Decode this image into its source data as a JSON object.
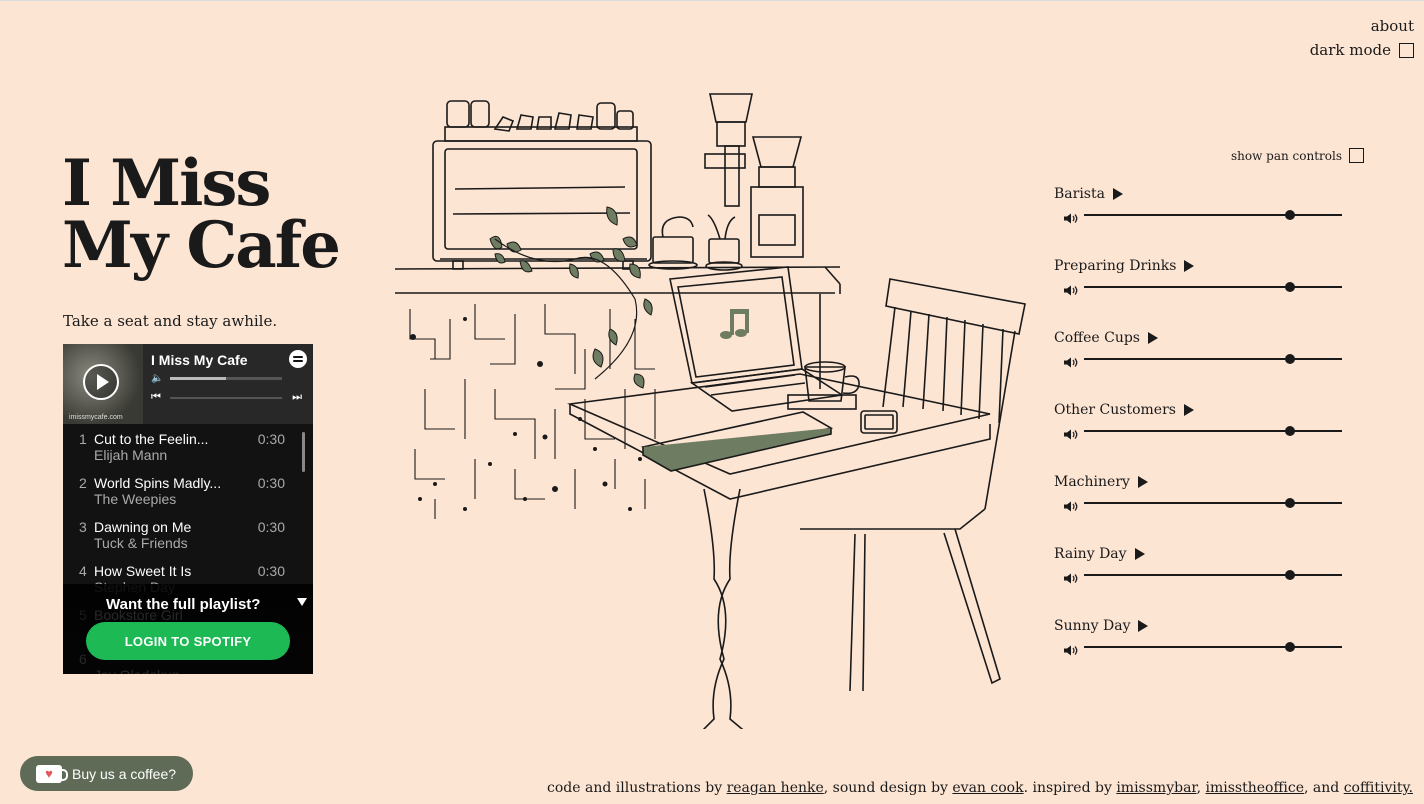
{
  "nav": {
    "about": "about",
    "dark_mode": "dark mode"
  },
  "hero": {
    "title_line1": "I Miss",
    "title_line2": "My Cafe",
    "tagline": "Take a seat and stay awhile."
  },
  "player": {
    "title": "I Miss My Cafe",
    "cover_text": "imissmycafe.com",
    "volume_fraction": 0.5,
    "tracks": [
      {
        "n": "1",
        "title": "Cut to the Feelin...",
        "artist": "Elijah Mann",
        "dur": "0:30"
      },
      {
        "n": "2",
        "title": "World Spins Madly...",
        "artist": "The Weepies",
        "dur": "0:30"
      },
      {
        "n": "3",
        "title": "Dawning on Me",
        "artist": "Tuck & Friends",
        "dur": "0:30"
      },
      {
        "n": "4",
        "title": "How Sweet It Is",
        "artist": "Stephen Day",
        "dur": "0:30"
      },
      {
        "n": "5",
        "title": "Bookstore Girl",
        "artist": "",
        "dur": ""
      },
      {
        "n": "6",
        "title": "",
        "artist": "Jay Oladokun",
        "dur": ""
      }
    ],
    "cta": "Want the full playlist?",
    "login": "LOGIN TO SPOTIFY"
  },
  "controls": {
    "pan_label": "show pan controls",
    "sounds": [
      {
        "name": "Barista",
        "volume": 0.8
      },
      {
        "name": "Preparing Drinks",
        "volume": 0.8
      },
      {
        "name": "Coffee Cups",
        "volume": 0.8
      },
      {
        "name": "Other Customers",
        "volume": 0.8
      },
      {
        "name": "Machinery",
        "volume": 0.8
      },
      {
        "name": "Rainy Day",
        "volume": 0.8
      },
      {
        "name": "Sunny Day",
        "volume": 0.8
      }
    ]
  },
  "coffee_button": "Buy us a coffee?",
  "footer": {
    "p1": "code and illustrations by ",
    "l1": "reagan henke",
    "p2": ", sound design by ",
    "l2": "evan cook",
    "p3": ". inspired by ",
    "l3": "imissmybar",
    "p4": ", ",
    "l4": "imisstheoffice",
    "p5": ", and ",
    "l5": "coffitivity."
  },
  "colors": {
    "background": "#fde5d4",
    "ink": "#1a1a1a",
    "leaf": "#6e7d62",
    "spotify_green": "#1db954",
    "coffee_button": "#5f6b57"
  }
}
